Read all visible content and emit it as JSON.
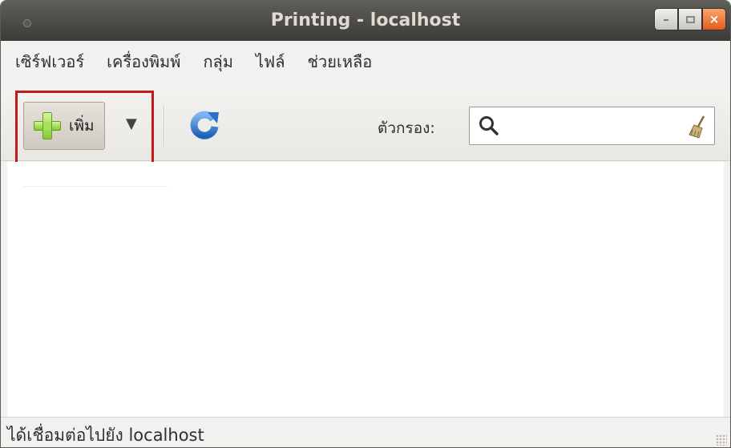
{
  "window": {
    "title": "Printing - localhost",
    "minimize_glyph": "–",
    "close_glyph": "×"
  },
  "menubar": {
    "items": [
      {
        "label": "เซิร์ฟเวอร์"
      },
      {
        "label": "เครื่องพิมพ์"
      },
      {
        "label": "กลุ่ม"
      },
      {
        "label": "ไฟล์"
      },
      {
        "label": "ช่วยเหลือ"
      }
    ]
  },
  "toolbar": {
    "add_label": "เพิ่ม",
    "dropdown_glyph": "▼",
    "filter_label": "ตัวกรอง:",
    "search": {
      "value": "",
      "placeholder": ""
    },
    "icons": {
      "add": "plus-icon",
      "refresh": "refresh-icon",
      "search": "search-icon",
      "clear": "broom-clear-icon"
    }
  },
  "statusbar": {
    "text": "ได้เชื่อมต่อไปยัง localhost"
  },
  "colors": {
    "titlebar": "#3c3b37",
    "close_button": "#e35b1c",
    "highlight": "#c21a1a",
    "plus_green": "#86c935",
    "refresh_blue": "#2e7fd6"
  }
}
